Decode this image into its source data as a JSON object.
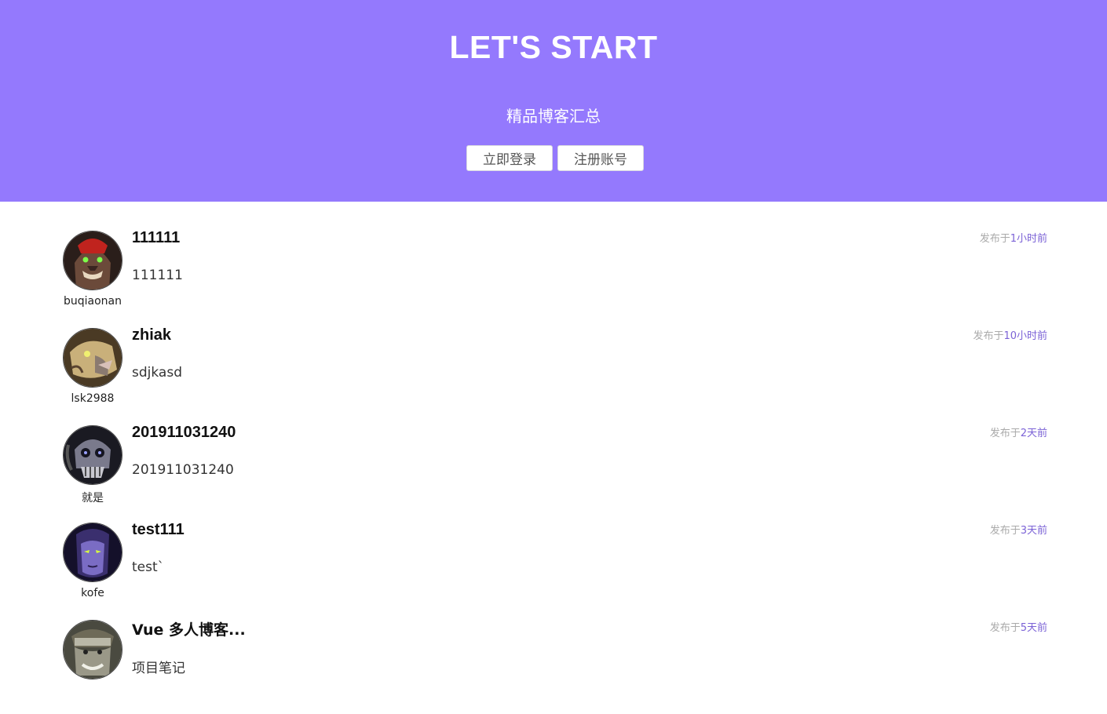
{
  "hero": {
    "title": "LET'S START",
    "subtitle": "精品博客汇总",
    "login_label": "立即登录",
    "register_label": "注册账号",
    "background_color": "#9479fd"
  },
  "posts": [
    {
      "author": "buqiaonan",
      "title": "111111",
      "excerpt": "111111",
      "time_prefix": "发布于",
      "time_ago": "1小时前",
      "avatar_icon": "red-orc-avatar-icon"
    },
    {
      "author": "lsk2988",
      "title": "zhiak",
      "excerpt": "sdjkasd",
      "time_prefix": "发布于",
      "time_ago": "10小时前",
      "avatar_icon": "tusked-beast-avatar-icon"
    },
    {
      "author": "就是",
      "title": "201911031240",
      "excerpt": "201911031240",
      "time_prefix": "发布于",
      "time_ago": "2天前",
      "avatar_icon": "skull-avatar-icon"
    },
    {
      "author": "kofe",
      "title": "test111",
      "excerpt": "test`",
      "time_prefix": "发布于",
      "time_ago": "3天前",
      "avatar_icon": "night-elf-avatar-icon"
    },
    {
      "author": "",
      "title": "Vue 多人博客...",
      "excerpt": "项目笔记",
      "time_prefix": "发布于",
      "time_ago": "5天前",
      "avatar_icon": "goblin-avatar-icon"
    }
  ],
  "colors": {
    "accent": "#7b62d6",
    "muted": "#aaaaaa"
  }
}
